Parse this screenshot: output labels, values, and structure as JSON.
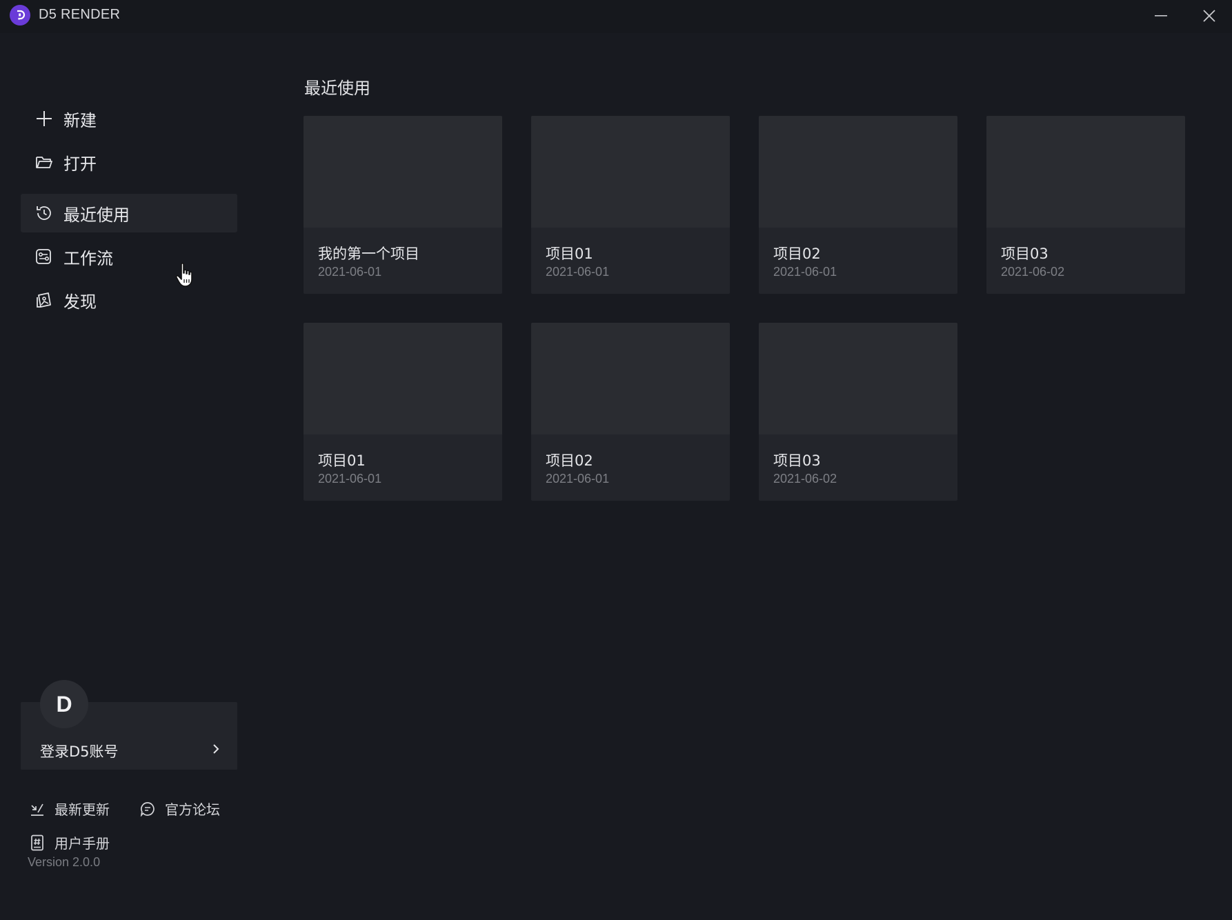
{
  "app": {
    "title": "D5 RENDER"
  },
  "sidebar": {
    "items": [
      {
        "label": "新建",
        "icon": "plus-icon"
      },
      {
        "label": "打开",
        "icon": "folder-icon"
      },
      {
        "label": "最近使用",
        "icon": "history-icon",
        "active": true
      },
      {
        "label": "工作流",
        "icon": "workflow-icon"
      },
      {
        "label": "发现",
        "icon": "discover-icon"
      }
    ],
    "account": {
      "avatar_letter": "D",
      "label": "登录D5账号"
    },
    "links": [
      {
        "label": "最新更新",
        "icon": "update-icon"
      },
      {
        "label": "官方论坛",
        "icon": "forum-icon"
      },
      {
        "label": "用户手册",
        "icon": "manual-icon"
      }
    ],
    "version": "Version 2.0.0"
  },
  "main": {
    "section_title": "最近使用",
    "projects": [
      {
        "name": "我的第一个项目",
        "date": "2021-06-01"
      },
      {
        "name": "项目01",
        "date": "2021-06-01"
      },
      {
        "name": "项目02",
        "date": "2021-06-01"
      },
      {
        "name": "项目03",
        "date": "2021-06-02"
      },
      {
        "name": "项目01",
        "date": "2021-06-01"
      },
      {
        "name": "项目02",
        "date": "2021-06-01"
      },
      {
        "name": "项目03",
        "date": "2021-06-02"
      }
    ]
  },
  "colors": {
    "accent": "#6a3bd8",
    "background": "#181a20",
    "card": "#23252b"
  }
}
